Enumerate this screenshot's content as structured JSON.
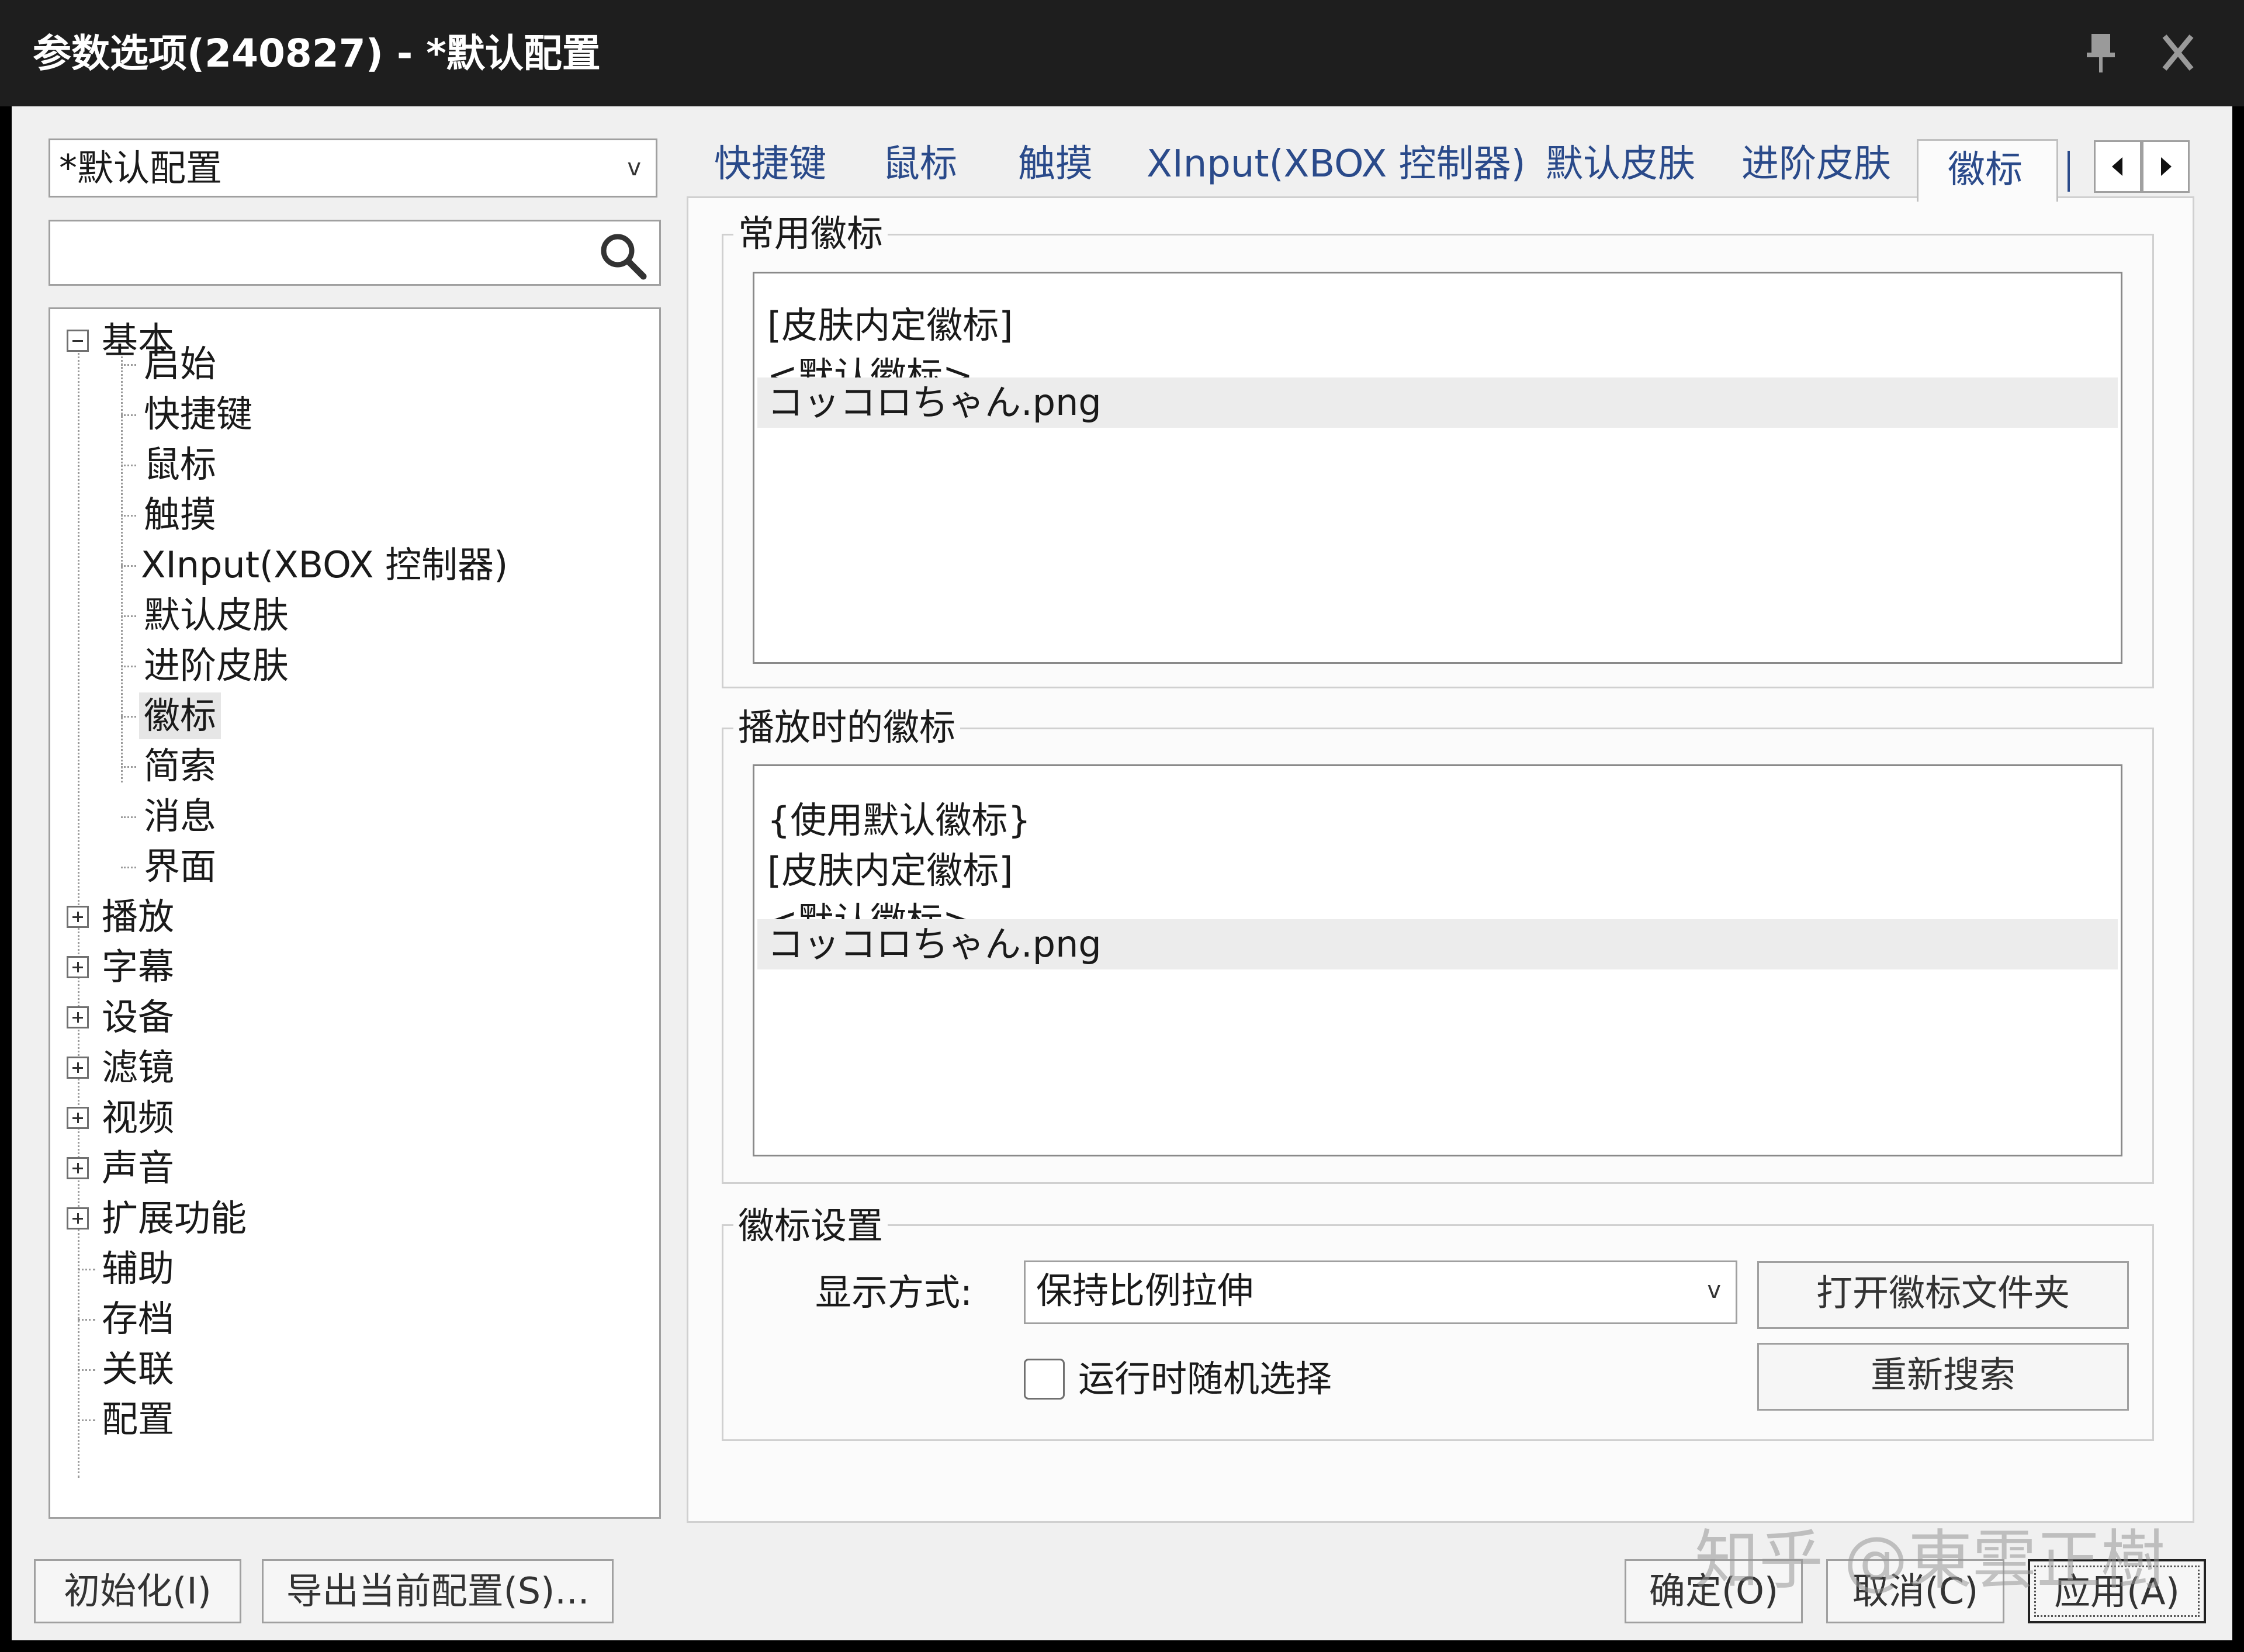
{
  "window": {
    "title": "参数选项(240827) - *默认配置",
    "pin_icon": "pin-icon",
    "close_icon": "close-icon"
  },
  "left": {
    "profile": "*默认配置",
    "search_value": "",
    "tree": {
      "basic": "基本",
      "basic_children": [
        "启始",
        "快捷键",
        "鼠标",
        "触摸",
        "XInput(XBOX 控制器)",
        "默认皮肤",
        "进阶皮肤",
        "徽标",
        "简索",
        "消息",
        "界面"
      ],
      "top_level": [
        "播放",
        "字幕",
        "设备",
        "滤镜",
        "视频",
        "声音",
        "扩展功能",
        "辅助",
        "存档",
        "关联",
        "配置"
      ],
      "selected": "徽标"
    }
  },
  "tabs": [
    "快捷键",
    "鼠标",
    "触摸",
    "XInput(XBOX 控制器)",
    "默认皮肤",
    "进阶皮肤",
    "徽标"
  ],
  "active_tab": "徽标",
  "common_logos": {
    "legend": "常用徽标",
    "items": [
      "[皮肤内定徽标]",
      "<默认徽标>",
      "コッコロちゃん.png"
    ]
  },
  "playing_logos": {
    "legend": "播放时的徽标",
    "items": [
      "{使用默认徽标}",
      "[皮肤内定徽标]",
      "<默认徽标>",
      "コッコロちゃん.png"
    ]
  },
  "logo_settings": {
    "legend": "徽标设置",
    "display_label": "显示方式:",
    "display_value": "保持比例拉伸",
    "open_folder": "打开徽标文件夹",
    "research": "重新搜索",
    "random_label": "运行时随机选择"
  },
  "footer": {
    "init": "初始化(I)",
    "export": "导出当前配置(S)...",
    "ok": "确定(O)",
    "cancel": "取消(C)",
    "apply": "应用(A)"
  },
  "watermark": "知乎 @東雲正樹",
  "colors": {
    "titlebar": "#1e1e1e",
    "tab_text": "#2a4a8a"
  }
}
